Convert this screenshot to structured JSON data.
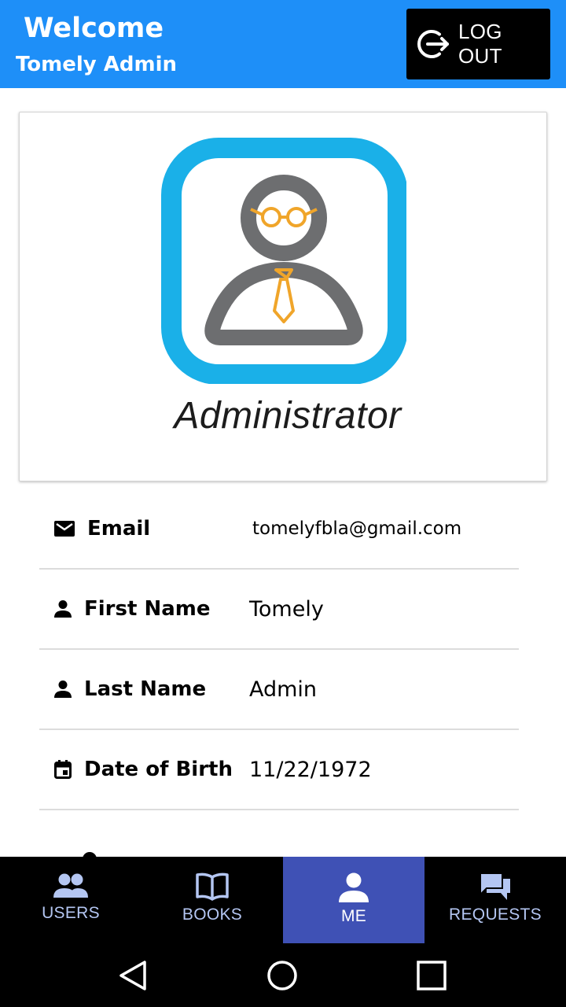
{
  "header": {
    "title": "Welcome",
    "subtitle": "Tomely Admin",
    "logout_label": "LOG OUT",
    "background_color": "#1e8ff8"
  },
  "profile_card": {
    "image_icon": "administrator-avatar-icon",
    "caption": "Administrator"
  },
  "info": [
    {
      "icon": "email-icon",
      "label": "Email",
      "value": "tomelyfbla@gmail.com"
    },
    {
      "icon": "person-icon",
      "label": "First Name",
      "value": "Tomely"
    },
    {
      "icon": "person-icon",
      "label": "Last Name",
      "value": "Admin"
    },
    {
      "icon": "calendar-icon",
      "label": "Date of Birth",
      "value": "11/22/1972"
    }
  ],
  "bottom_nav": {
    "items": [
      {
        "icon": "users-icon",
        "label": "USERS",
        "active": false
      },
      {
        "icon": "book-icon",
        "label": "BOOKS",
        "active": false
      },
      {
        "icon": "person-icon",
        "label": "ME",
        "active": true
      },
      {
        "icon": "chat-bubbles-icon",
        "label": "REQUESTS",
        "active": false
      }
    ],
    "active_color": "#3f51b5",
    "inactive_text_color": "#b4c6f2"
  },
  "system_nav": {
    "back": "back-icon",
    "home": "home-icon",
    "recents": "recents-icon"
  }
}
